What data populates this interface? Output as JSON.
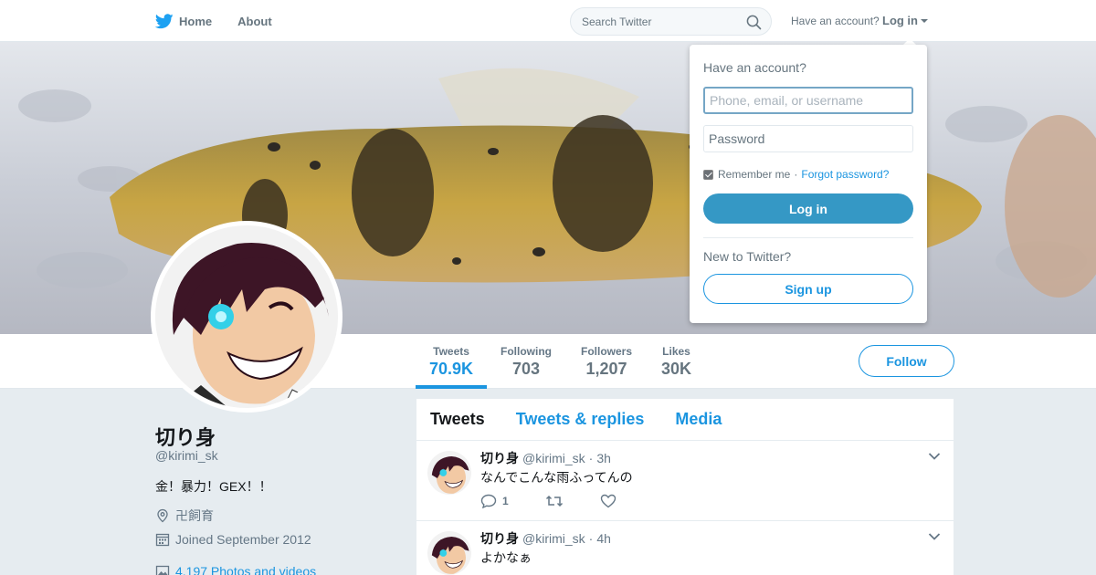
{
  "colors": {
    "accent": "#1b95e0",
    "login_button": "#3598c5",
    "background": "#e6ecf0"
  },
  "nav": {
    "home_label": "Home",
    "about_label": "About",
    "search_placeholder": "Search Twitter",
    "have_account": "Have an account?",
    "login_label": "Log in"
  },
  "profile": {
    "name": "切り身",
    "handle": "@kirimi_sk",
    "bio": "金！暴力！GEX！！",
    "location": "卍飼育",
    "joined": "Joined September 2012",
    "photos": "4,197 Photos and videos"
  },
  "stats": [
    {
      "label": "Tweets",
      "value": "70.9K"
    },
    {
      "label": "Following",
      "value": "703"
    },
    {
      "label": "Followers",
      "value": "1,207"
    },
    {
      "label": "Likes",
      "value": "30K"
    }
  ],
  "follow_label": "Follow",
  "tabs": [
    "Tweets",
    "Tweets & replies",
    "Media"
  ],
  "tweets": [
    {
      "name": "切り身",
      "handle": "@kirimi_sk",
      "time": "3h",
      "text": "なんでこんな雨ふってんの",
      "reply_count": "1"
    },
    {
      "name": "切り身",
      "handle": "@kirimi_sk",
      "time": "4h",
      "text": "よかなぁ",
      "reply_count": ""
    }
  ],
  "dropdown": {
    "title": "Have an account?",
    "username_placeholder": "Phone, email, or username",
    "password_placeholder": "Password",
    "remember": "Remember me",
    "separator": "·",
    "forgot": "Forgot password?",
    "login_button": "Log in",
    "new_to": "New to Twitter?",
    "signup_button": "Sign up"
  }
}
